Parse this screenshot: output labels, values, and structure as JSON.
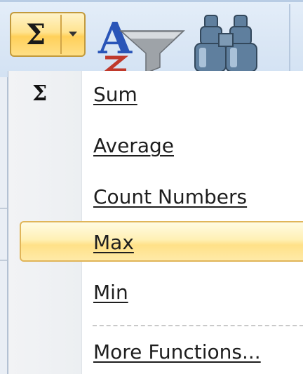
{
  "ribbon": {
    "sum_button": {
      "glyph": "Σ",
      "icon": "sigma-icon",
      "accent": "#ffd05a"
    },
    "dropdown_arrow_icon": "chevron-down-icon",
    "sort_filter_icon": "sort-filter-icon",
    "find_select_icon": "binoculars-icon"
  },
  "menu": {
    "checked_glyph": "Σ",
    "items": [
      {
        "label": "Sum",
        "checked": true,
        "hover": false
      },
      {
        "label": "Average",
        "checked": false,
        "hover": false
      },
      {
        "label": "Count Numbers",
        "checked": false,
        "hover": false
      },
      {
        "label": "Max",
        "checked": false,
        "hover": true
      },
      {
        "label": "Min",
        "checked": false,
        "hover": false
      },
      {
        "label": "More Functions...",
        "checked": false,
        "hover": false
      }
    ],
    "highlight_color": "#ffe188"
  }
}
